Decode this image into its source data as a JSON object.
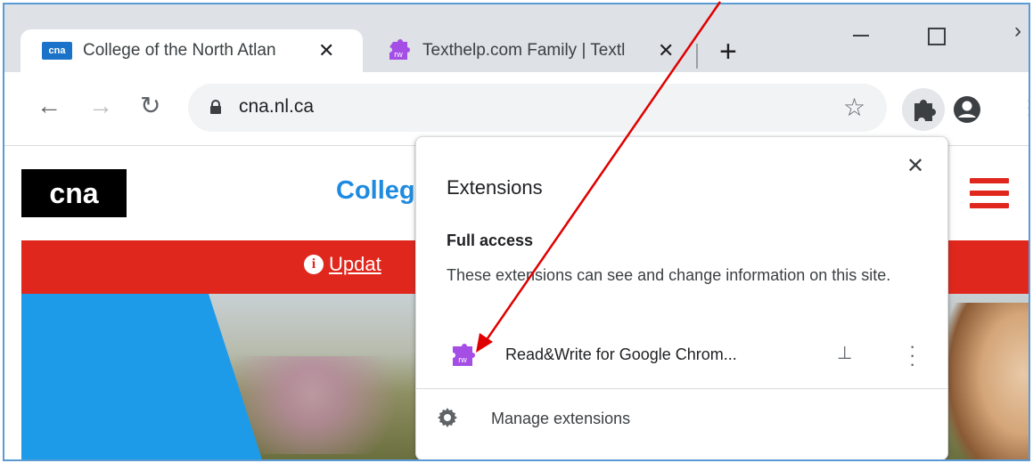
{
  "tabs": [
    {
      "favicon": "cna",
      "title": "College of the North Atlan",
      "close": "✕"
    },
    {
      "favicon": "rw",
      "title": "Texthelp.com Family | Textl",
      "close": "✕"
    }
  ],
  "new_tab_label": "+",
  "address_bar": {
    "url": "cna.nl.ca"
  },
  "page": {
    "logo_text": "cna",
    "site_title": "Colleg",
    "banner_link": "Updat"
  },
  "extensions_popup": {
    "title": "Extensions",
    "close": "✕",
    "section_title": "Full access",
    "section_description": "These extensions can see and change information on this site.",
    "extension_name": "Read&Write for Google Chrom...",
    "manage_label": "Manage extensions"
  },
  "colors": {
    "accent_blue": "#1f8be0",
    "banner_red": "#e0271d",
    "rw_purple": "#9b3fd8",
    "annotation_arrow": "#e00000"
  },
  "icons": [
    "lock-icon",
    "star-icon",
    "puzzle-icon",
    "profile-icon",
    "gear-icon",
    "pin-icon",
    "kebab-icon"
  ]
}
